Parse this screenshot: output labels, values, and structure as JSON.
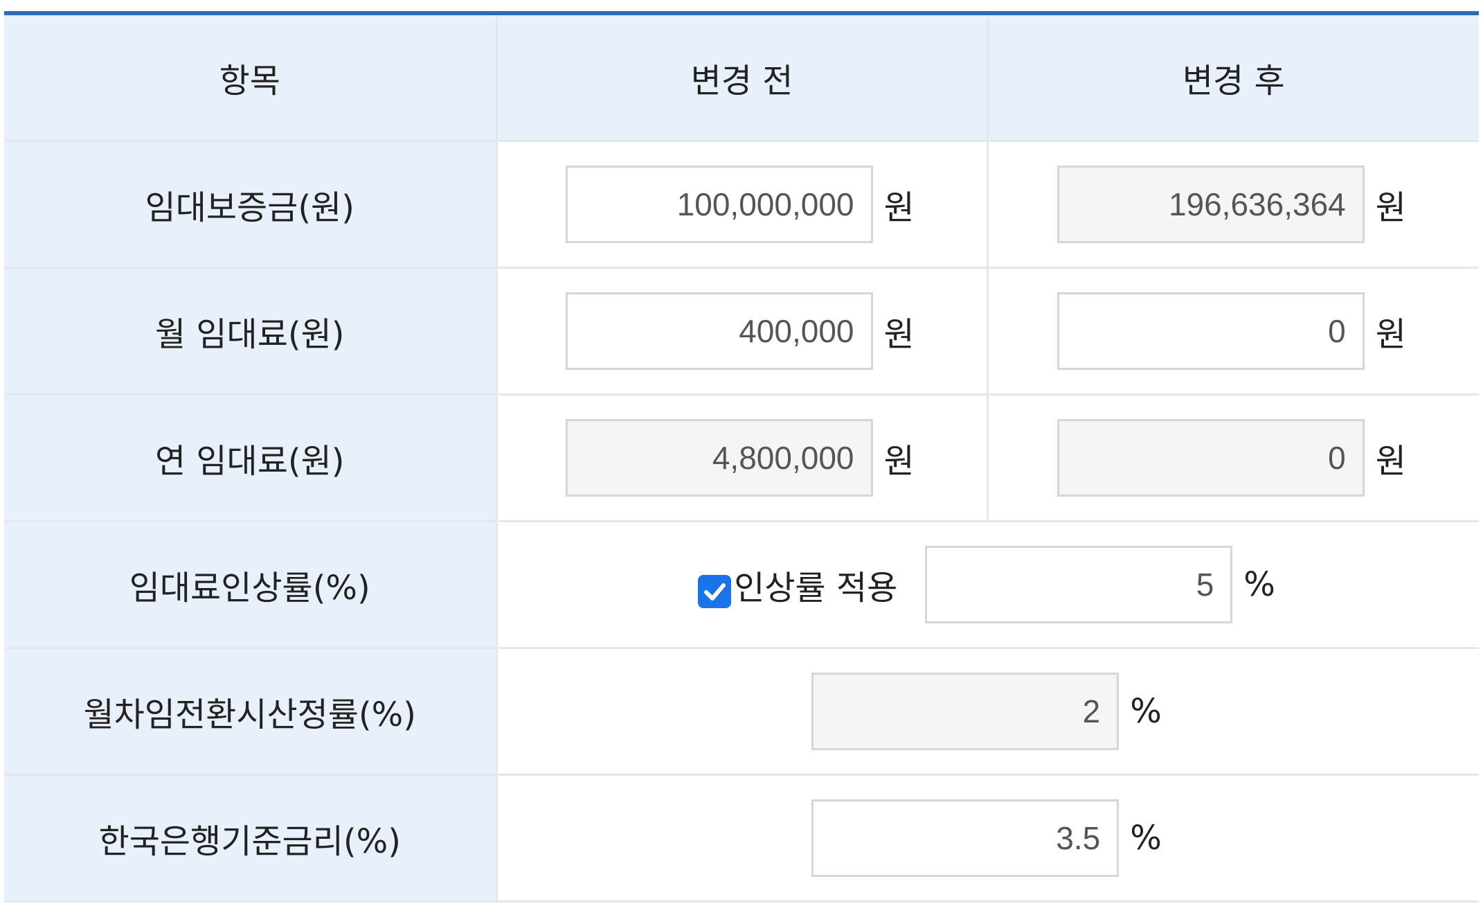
{
  "header": {
    "col_item": "항목",
    "col_before": "변경 전",
    "col_after": "변경 후"
  },
  "rows": {
    "deposit": {
      "label": "임대보증금(원)",
      "before": "100,000,000",
      "after": "196,636,364",
      "unit": "원"
    },
    "monthly_rent": {
      "label": "월 임대료(원)",
      "before": "400,000",
      "after": "0",
      "unit": "원"
    },
    "yearly_rent": {
      "label": "연 임대료(원)",
      "before": "4,800,000",
      "after": "0",
      "unit": "원"
    },
    "rent_increase": {
      "label": "임대료인상률(%)",
      "checkbox_label": "인상률 적용",
      "checked": true,
      "value": "5",
      "unit": "%"
    },
    "conversion_rate": {
      "label": "월차임전환시산정률(%)",
      "value": "2",
      "unit": "%"
    },
    "bok_base_rate": {
      "label": "한국은행기준금리(%)",
      "value": "3.5",
      "unit": "%"
    }
  },
  "colors": {
    "accent": "#2e6db4",
    "header_bg": "#e8f0fb",
    "checkbox": "#1a73e8",
    "readonly_bg": "#f5f5f5"
  }
}
